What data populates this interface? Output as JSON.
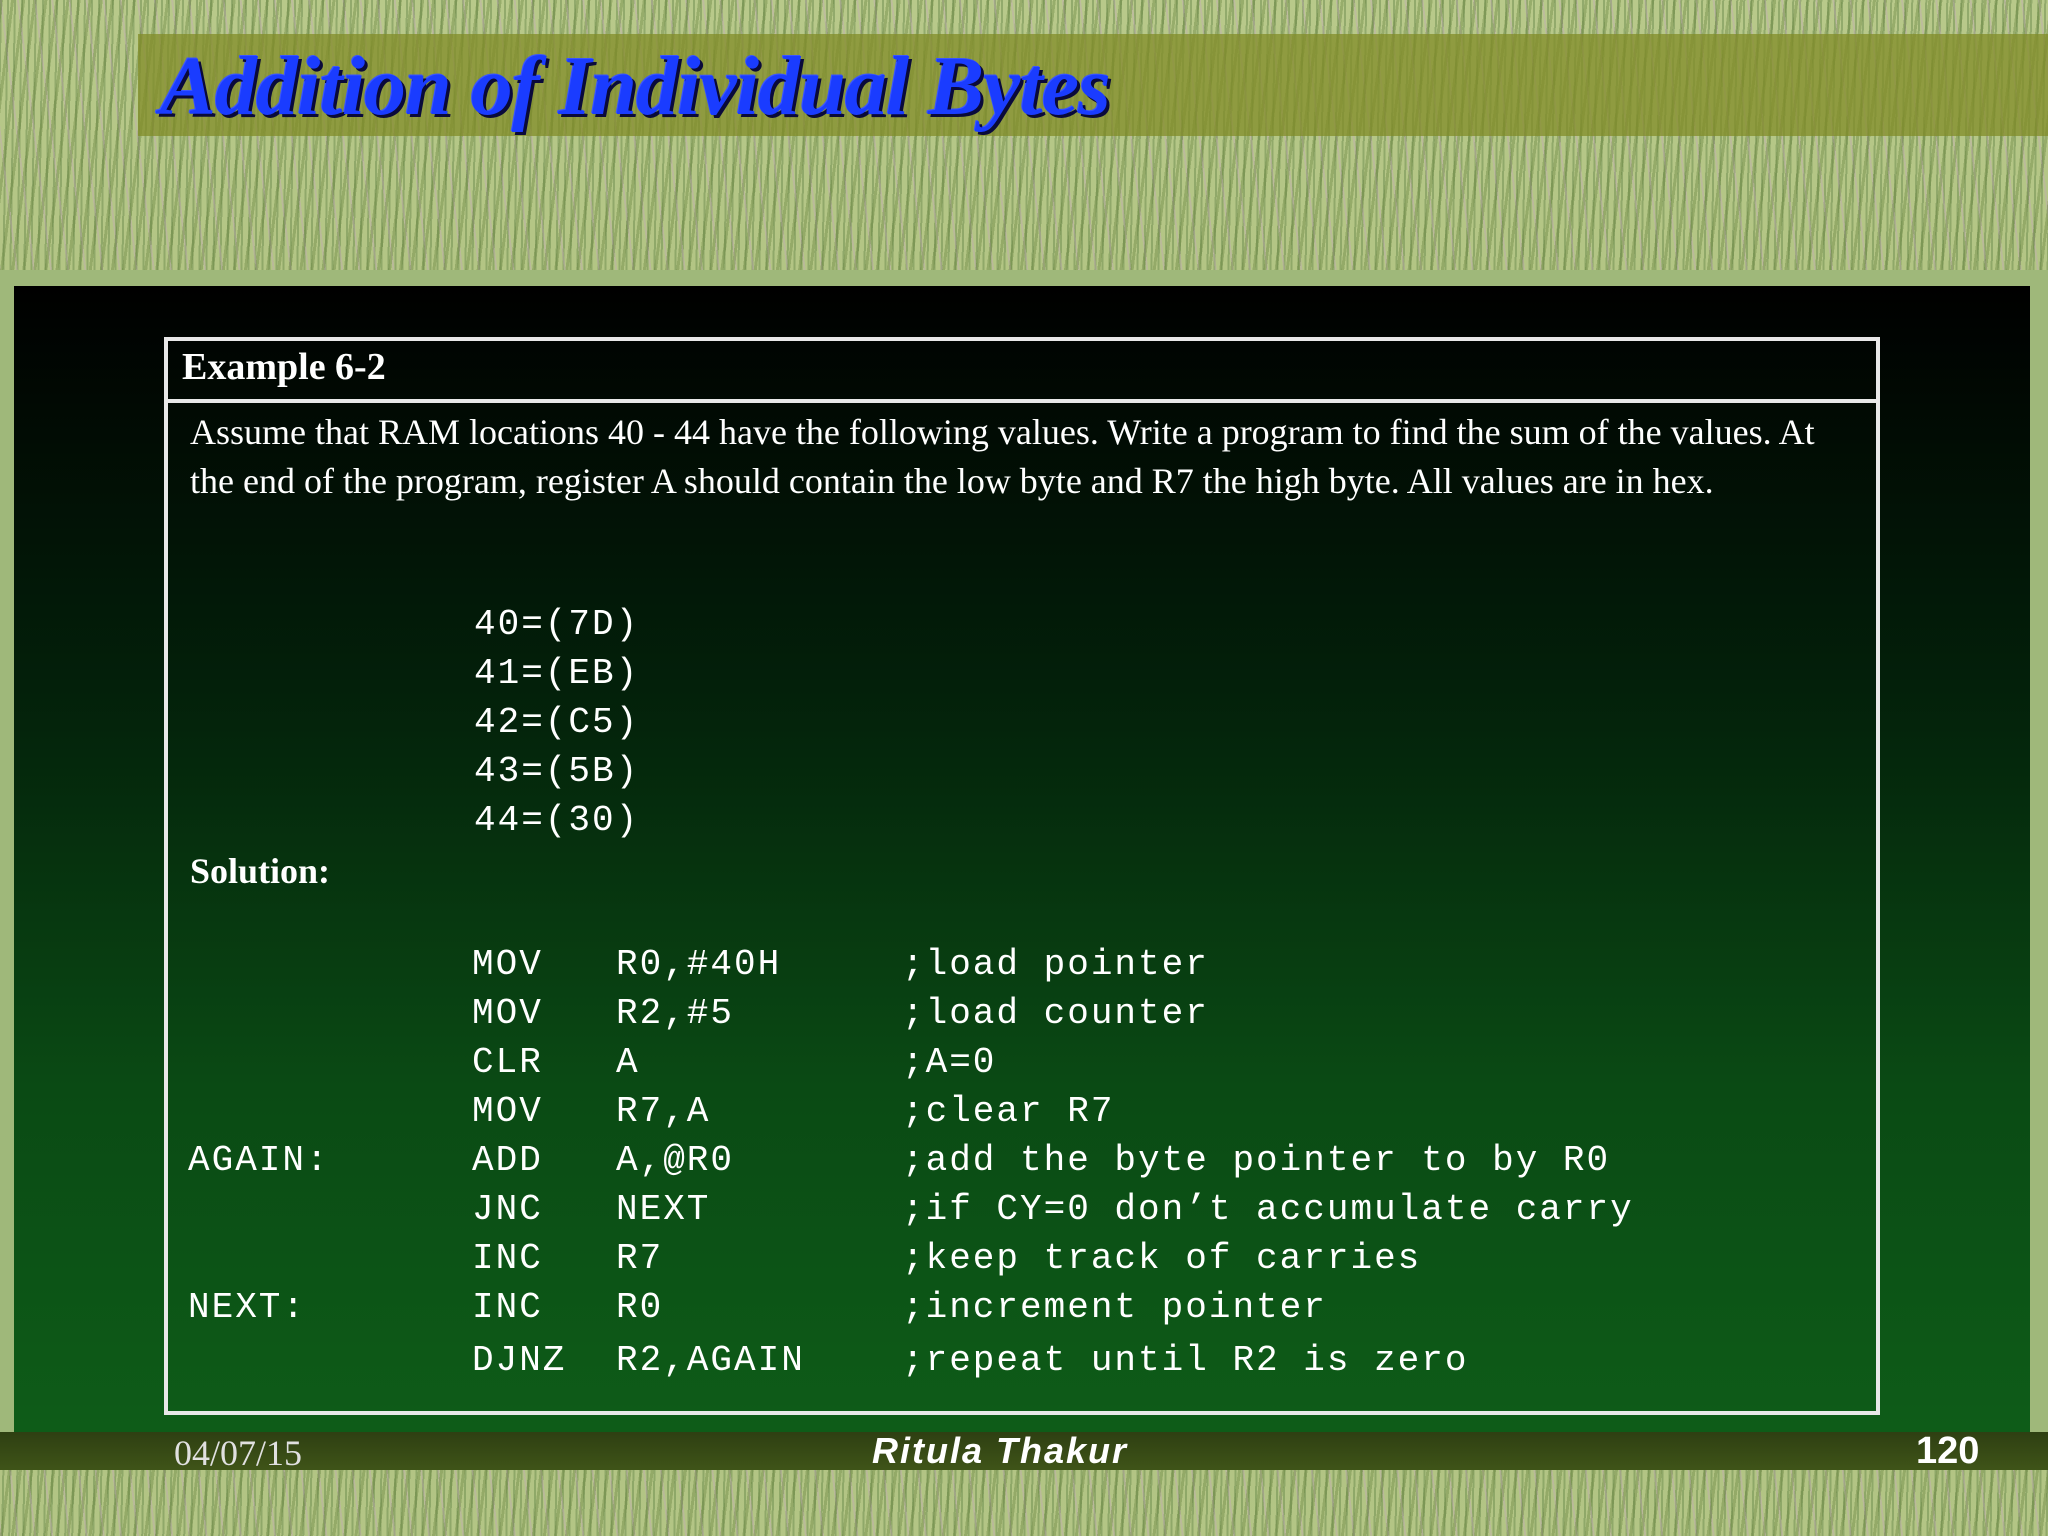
{
  "slide": {
    "title": "Addition of Individual Bytes"
  },
  "example": {
    "heading": "Example 6-2",
    "prose": "Assume that RAM locations 40 - 44 have the following values. Write a program to find the sum of the values. At the end of the program, register A should contain the low byte and R7 the high byte. All values are in hex.",
    "values": [
      "40=(7D)",
      "41=(EB)",
      "42=(C5)",
      "43=(5B)",
      "44=(30)"
    ],
    "solution_label": "Solution:",
    "code": [
      {
        "label": "",
        "op": "MOV",
        "args": "R0,#40H",
        "comment": ";load pointer"
      },
      {
        "label": "",
        "op": "MOV",
        "args": "R2,#5",
        "comment": ";load counter"
      },
      {
        "label": "",
        "op": "CLR",
        "args": "A",
        "comment": ";A=0"
      },
      {
        "label": "",
        "op": "MOV",
        "args": "R7,A",
        "comment": ";clear R7"
      },
      {
        "label": "AGAIN:",
        "op": "ADD",
        "args": "A,@R0",
        "comment": ";add the byte pointer to by R0"
      },
      {
        "label": "",
        "op": "JNC",
        "args": "NEXT",
        "comment": ";if CY=0 don’t accumulate carry"
      },
      {
        "label": "",
        "op": "INC",
        "args": "R7",
        "comment": ";keep track of carries"
      },
      {
        "label": "NEXT:",
        "op": "INC",
        "args": "R0",
        "comment": ";increment pointer"
      },
      {
        "label": "",
        "op": "DJNZ",
        "args": "R2,AGAIN",
        "comment": ";repeat until R2 is zero"
      }
    ]
  },
  "footer": {
    "date": "04/07/15",
    "author": "Ritula Thakur",
    "page": "120"
  }
}
